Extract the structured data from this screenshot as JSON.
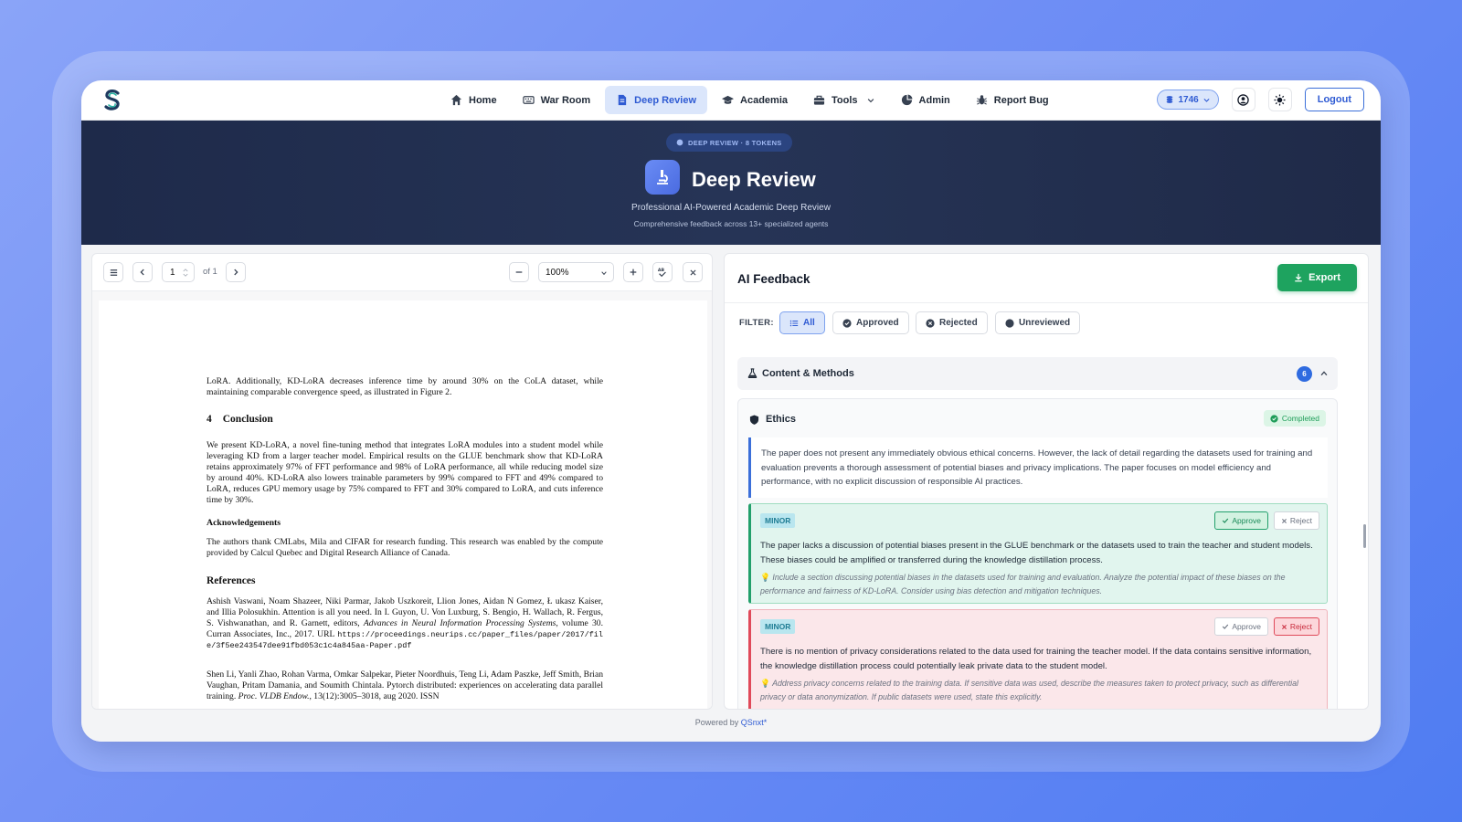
{
  "nav": {
    "items": [
      {
        "label": "Home",
        "icon": "home-icon"
      },
      {
        "label": "War Room",
        "icon": "keyboard-icon"
      },
      {
        "label": "Deep Review",
        "icon": "document-icon"
      },
      {
        "label": "Academia",
        "icon": "graduation-cap-icon"
      },
      {
        "label": "Tools",
        "icon": "toolbox-icon"
      },
      {
        "label": "Admin",
        "icon": "chart-pie-icon"
      },
      {
        "label": "Report Bug",
        "icon": "bug-icon"
      }
    ],
    "tokens": "1746",
    "logout": "Logout"
  },
  "hero": {
    "badge": "DEEP REVIEW · 8 TOKENS",
    "title": "Deep Review",
    "subtitle": "Professional AI-Powered Academic Deep Review",
    "subtitle2": "Comprehensive feedback across 13+ specialized agents"
  },
  "pdf": {
    "page": "1",
    "of": "of 1",
    "zoom": "100%",
    "para1": "LoRA. Additionally, KD-LoRA decreases inference time by around 30% on the CoLA dataset, while maintaining comparable convergence speed, as illustrated in Figure 2.",
    "heading_num": "4",
    "heading": "Conclusion",
    "conclusion": "We present KD-LoRA, a novel fine-tuning method that integrates LoRA modules into a student model while leveraging KD from a larger teacher model. Empirical results on the GLUE benchmark show that KD-LoRA retains approximately 97% of FFT performance and 98% of LoRA performance, all while reducing model size by around 40%. KD-LoRA also lowers trainable parameters by 99% compared to FFT and 49% compared to LoRA, reduces GPU memory usage by 75% compared to FFT and 30% compared to LoRA, and cuts inference time by 30%.",
    "ack_heading": "Acknowledgements",
    "ack": "The authors thank CMLabs, Mila and CIFAR for research funding. This research was enabled by the compute provided by Calcul Quebec and Digital Research Alliance of Canada.",
    "refs_heading": "References",
    "ref1_a": "Ashish Vaswani, Noam Shazeer, Niki Parmar, Jakob Uszkoreit, Llion Jones, Aidan N Gomez, Ł ukasz Kaiser, and Illia Polosukhin. Attention is all you need. In I. Guyon, U. Von Luxburg, S. Bengio, H. Wallach, R. Fergus, S. Vishwanathan, and R. Garnett, editors,",
    "ref1_venue": "Advances in Neural Information Processing Systems",
    "ref1_b": ", volume 30. Curran Associates, Inc., 2017. URL",
    "ref1_url": "https://proceedings.neurips.cc/paper_files/paper/2017/file/3f5ee243547dee91fbd053c1c4a845aa-Paper.pdf",
    "ref2_a": "Shen Li, Yanli Zhao, Rohan Varma, Omkar Salpekar, Pieter Noordhuis, Teng Li, Adam Paszke, Jeff Smith, Brian Vaughan, Pritam Damania, and Soumith Chintala. Pytorch distributed: experiences on accelerating data parallel training.",
    "ref2_venue": "Proc. VLDB Endow.",
    "ref2_b": ", 13(12):3005–3018, aug 2020. ISSN"
  },
  "feedback": {
    "title": "AI Feedback",
    "export": "Export",
    "filter_label": "FILTER:",
    "filters": [
      "All",
      "Approved",
      "Rejected",
      "Unreviewed"
    ],
    "section": {
      "title": "Content & Methods",
      "count": "6"
    },
    "ethics": {
      "title": "Ethics",
      "status": "Completed",
      "summary": "The paper does not present any immediately obvious ethical concerns. However, the lack of detail regarding the datasets used for training and evaluation prevents a thorough assessment of potential biases and privacy implications. The paper focuses on model efficiency and performance, with no explicit discussion of responsible AI practices."
    },
    "issues": [
      {
        "severity": "MINOR",
        "approve": "Approve",
        "reject": "Reject",
        "text": "The paper lacks a discussion of potential biases present in the GLUE benchmark or the datasets used to train the teacher and student models. These biases could be amplified or transferred during the knowledge distillation process.",
        "hint": "Include a section discussing potential biases in the datasets used for training and evaluation. Analyze the potential impact of these biases on the performance and fairness of KD-LoRA. Consider using bias detection and mitigation techniques."
      },
      {
        "severity": "MINOR",
        "approve": "Approve",
        "reject": "Reject",
        "text": "There is no mention of privacy considerations related to the data used for training the teacher model. If the data contains sensitive information, the knowledge distillation process could potentially leak private data to the student model.",
        "hint": "Address privacy concerns related to the training data. If sensitive data was used, describe the measures taken to protect privacy, such as differential privacy or data anonymization. If public datasets were used, state this explicitly."
      }
    ]
  },
  "footer": {
    "prefix": "Powered by",
    "brand": "QSnxt*"
  },
  "colors": {
    "accent": "#2f5bd3",
    "success": "#1ea35f",
    "danger": "#e04a5a",
    "hero": "#1e2a4a"
  }
}
